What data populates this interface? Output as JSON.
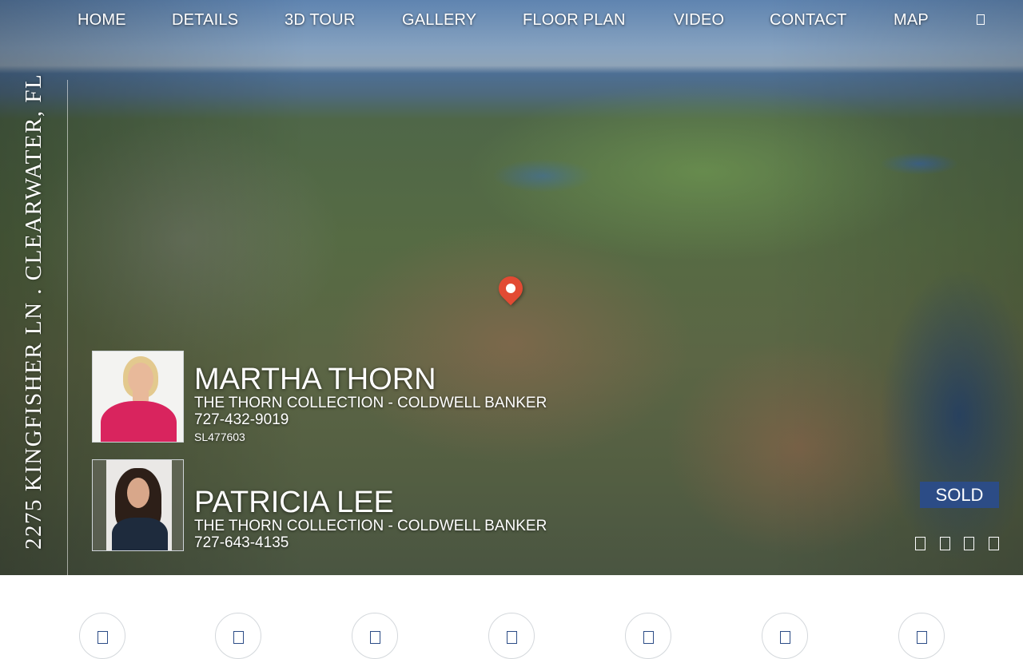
{
  "nav": {
    "items": [
      {
        "label": "HOME"
      },
      {
        "label": "DETAILS"
      },
      {
        "label": "3D TOUR"
      },
      {
        "label": "GALLERY"
      },
      {
        "label": "FLOOR PLAN"
      },
      {
        "label": "VIDEO"
      },
      {
        "label": "CONTACT"
      },
      {
        "label": "MAP"
      }
    ],
    "extra_icon": "menu-icon"
  },
  "address": {
    "vertical_text": "2275 KINGFISHER LN . CLEARWATER, FL"
  },
  "map_pin_icon": "home-location-pin-icon",
  "agents": [
    {
      "name": "MARTHA THORN",
      "company": "THE THORN COLLECTION - COLDWELL BANKER",
      "phone": "727-432-9019",
      "license": "SL477603"
    },
    {
      "name": "PATRICIA LEE",
      "company": "THE THORN COLLECTION - COLDWELL BANKER",
      "phone": "727-643-4135"
    }
  ],
  "status_badge": "SOLD",
  "colors": {
    "accent": "#2c4c86",
    "pin": "#e24a33"
  },
  "slider": {
    "dot_count": 4
  },
  "bottom_buttons": [
    {
      "icon": "details-icon"
    },
    {
      "icon": "tour-icon"
    },
    {
      "icon": "gallery-icon"
    },
    {
      "icon": "floor-plan-icon"
    },
    {
      "icon": "video-icon"
    },
    {
      "icon": "contact-icon"
    },
    {
      "icon": "map-icon"
    }
  ]
}
